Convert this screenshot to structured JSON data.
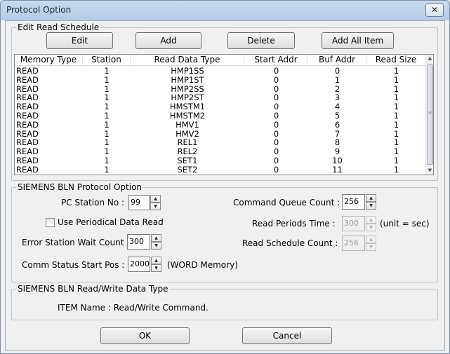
{
  "window": {
    "title": "Protocol Option",
    "close_glyph": "✕"
  },
  "schedule": {
    "legend": "Edit Read Schedule",
    "buttons": {
      "edit": "Edit",
      "add": "Add",
      "delete": "Delete",
      "add_all": "Add All Item"
    },
    "columns": [
      "Memory Type",
      "Station",
      "Read Data Type",
      "Start Addr",
      "Buf Addr",
      "Read Size"
    ],
    "rows": [
      [
        "READ",
        "1",
        "HMP1SS",
        "0",
        "0",
        "1"
      ],
      [
        "READ",
        "1",
        "HMP1ST",
        "0",
        "1",
        "1"
      ],
      [
        "READ",
        "1",
        "HMP2SS",
        "0",
        "2",
        "1"
      ],
      [
        "READ",
        "1",
        "HMP2ST",
        "0",
        "3",
        "1"
      ],
      [
        "READ",
        "1",
        "HMSTM1",
        "0",
        "4",
        "1"
      ],
      [
        "READ",
        "1",
        "HMSTM2",
        "0",
        "5",
        "1"
      ],
      [
        "READ",
        "1",
        "HMV1",
        "0",
        "6",
        "1"
      ],
      [
        "READ",
        "1",
        "HMV2",
        "0",
        "7",
        "1"
      ],
      [
        "READ",
        "1",
        "REL1",
        "0",
        "8",
        "1"
      ],
      [
        "READ",
        "1",
        "REL2",
        "0",
        "9",
        "1"
      ],
      [
        "READ",
        "1",
        "SET1",
        "0",
        "10",
        "1"
      ],
      [
        "READ",
        "1",
        "SET2",
        "0",
        "11",
        "1"
      ]
    ]
  },
  "protocol": {
    "legend": "SIEMENS BLN  Protocol Option",
    "pc_station_label": "PC Station No :",
    "pc_station_value": "99",
    "use_periodical_label": "Use Periodical Data Read",
    "use_periodical_checked": false,
    "error_wait_label": "Error Station Wait Count :",
    "error_wait_value": "300",
    "comm_status_label": "Comm Status Start Pos :",
    "comm_status_value": "2000",
    "comm_status_unit": "(WORD Memory)",
    "cmd_queue_label": "Command Queue Count :",
    "cmd_queue_value": "256",
    "read_periods_label": "Read Periods Time :",
    "read_periods_value": "300",
    "read_periods_unit": "(unit = sec)",
    "read_schedule_label": "Read Schedule Count :",
    "read_schedule_value": "256"
  },
  "rw": {
    "legend": "SIEMENS BLN Read/Write Data Type",
    "item_text": "ITEM Name : Read/Write Command."
  },
  "footer": {
    "ok": "OK",
    "cancel": "Cancel"
  },
  "icons": {
    "spin_up": "▲",
    "spin_down": "▼",
    "scroll_up": "▲",
    "scroll_down": "▼",
    "grip": "≡"
  }
}
